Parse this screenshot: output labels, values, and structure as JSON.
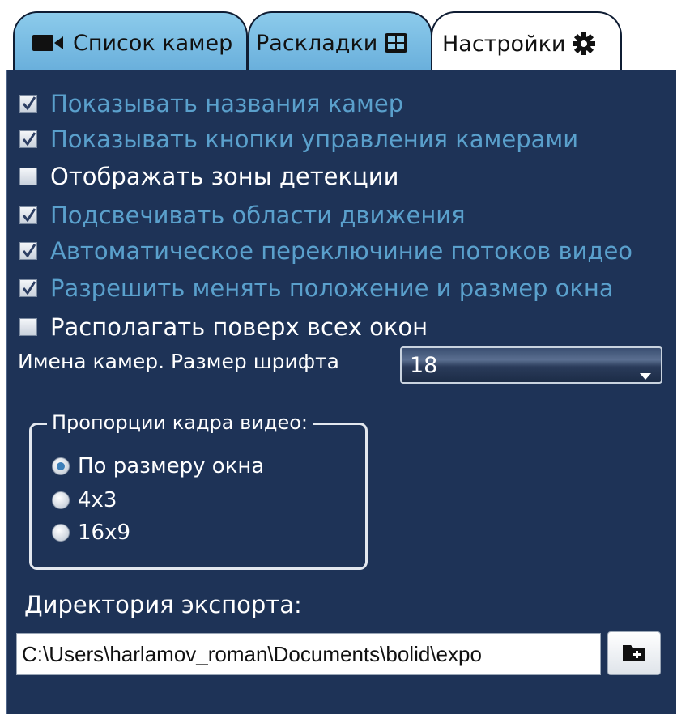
{
  "tabs": {
    "cameras": {
      "label": "Список камер",
      "icon": "video-camera-icon"
    },
    "layouts": {
      "label": "Раскладки",
      "icon": "grid-layout-icon"
    },
    "settings": {
      "label": "Настройки",
      "icon": "gear-icon",
      "active": true
    }
  },
  "options": [
    {
      "label": "Показывать названия камер",
      "checked": true
    },
    {
      "label": "Показывать кнопки управления камерами",
      "checked": true
    },
    {
      "label": "Отображать зоны детекции",
      "checked": false
    },
    {
      "label": "Подсвечивать области движения",
      "checked": true
    },
    {
      "label": "Автоматическое переключиние потоков видео",
      "checked": true
    },
    {
      "label": "Разрешить менять положение и размер окна",
      "checked": true
    },
    {
      "label": "Располагать поверх всех окон",
      "checked": false
    }
  ],
  "font_size": {
    "label": "Имена камер. Размер шрифта",
    "value": "18"
  },
  "aspect": {
    "title": "Пропорции кадра видео:",
    "options": [
      {
        "label": "По размеру окна",
        "selected": true
      },
      {
        "label": "4x3",
        "selected": false
      },
      {
        "label": "16x9",
        "selected": false
      }
    ]
  },
  "export": {
    "label": "Директория экспорта:",
    "path": "C:\\Users\\harlamov_roman\\Documents\\bolid\\expo"
  },
  "colors": {
    "panel_bg": "#1e3357",
    "checked_text": "#5aa0cc",
    "tab_bg": "#7cbde6"
  }
}
